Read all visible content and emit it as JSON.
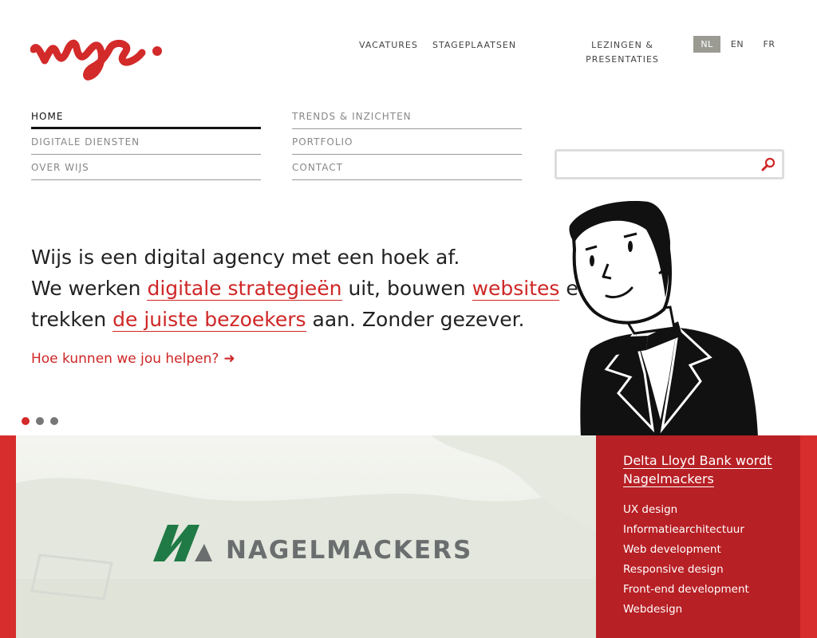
{
  "topnav": {
    "vacatures": "VACATURES",
    "stageplaatsen": "STAGEPLAATSEN",
    "lezingen_line1": "LEZINGEN &",
    "lezingen_line2": "PRESENTATIES"
  },
  "languages": {
    "nl": "NL",
    "en": "EN",
    "fr": "FR",
    "active": "NL"
  },
  "mainnav": {
    "home": "HOME",
    "digitale_diensten": "DIGITALE DIENSTEN",
    "over_wijs": "OVER WIJS",
    "trends": "TRENDS & INZICHTEN",
    "portfolio": "PORTFOLIO",
    "contact": "CONTACT"
  },
  "search": {
    "value": "",
    "placeholder": ""
  },
  "hero": {
    "line1": "Wijs is een digital agency met een hoek af.",
    "line2_pre": "We werken ",
    "line2_link1": "digitale strategieën",
    "line2_mid": " uit, bouwen ",
    "line2_link2": "websites",
    "line2_post": " en",
    "line3_pre": "trekken ",
    "line3_link": "de juiste bezoekers",
    "line3_post": " aan. Zonder gezever.",
    "cta": "Hoe kunnen we jou helpen?"
  },
  "slider": {
    "count": 3,
    "active_index": 0
  },
  "case": {
    "brand": "NAGELMACKERS",
    "title": "Delta Lloyd Bank wordt Nagelmackers",
    "services": [
      "UX design",
      "Informatiearchitectuur",
      "Web development",
      "Responsive design",
      "Front-end development",
      "Webdesign"
    ]
  },
  "colors": {
    "accent": "#cf2626",
    "band": "#d72d2d",
    "case_bg": "#b72025",
    "brand_green": "#1f7a45",
    "lang_active_bg": "#9b9b94"
  }
}
